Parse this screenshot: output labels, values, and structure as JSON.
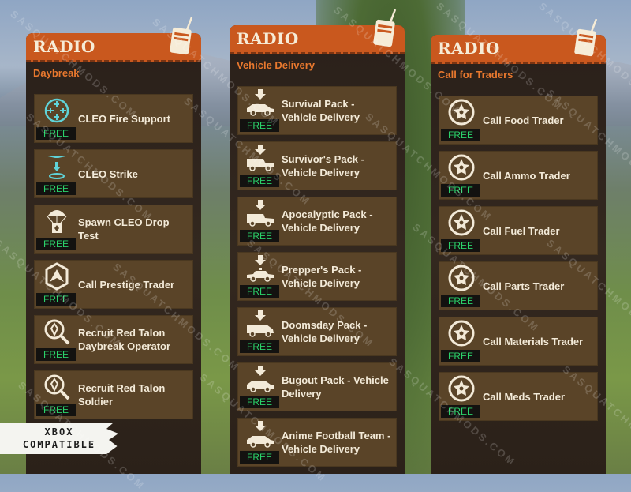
{
  "watermark": "SASQUATCHMODS.COM",
  "badge": {
    "line1": "XBOX",
    "line2": "COMPATIBLE"
  },
  "colors": {
    "header": "#c9581e",
    "subtitle": "#e8782e",
    "free": "#2bd26a",
    "item_bg": "#5a4428"
  },
  "panels": [
    {
      "title": "RADIO",
      "subtitle": "Daybreak",
      "items": [
        {
          "label": "CLEO Fire Support",
          "icon": "crosshair-icon",
          "price": "FREE"
        },
        {
          "label": "CLEO Strike",
          "icon": "airstrike-icon",
          "price": "FREE"
        },
        {
          "label": "Spawn CLEO Drop Test",
          "icon": "parachute-drop-icon",
          "price": "FREE"
        },
        {
          "label": "Call Prestige Trader",
          "icon": "prestige-chevron-icon",
          "price": "FREE"
        },
        {
          "label": "Recruit Red Talon Daybreak Operator",
          "icon": "recruit-search-icon",
          "price": "FREE"
        },
        {
          "label": "Recruit Red Talon Soldier",
          "icon": "recruit-search-icon",
          "price": "FREE"
        }
      ]
    },
    {
      "title": "RADIO",
      "subtitle": "Vehicle Delivery",
      "items": [
        {
          "label": "Survival Pack - Vehicle Delivery",
          "icon": "car-delivery-icon",
          "price": "FREE"
        },
        {
          "label": "Survivor's Pack - Vehicle Delivery",
          "icon": "jeep-delivery-icon",
          "price": "FREE"
        },
        {
          "label": "Apocalyptic Pack - Vehicle Delivery",
          "icon": "jeep-delivery-icon",
          "price": "FREE"
        },
        {
          "label": "Prepper's Pack - Vehicle Delivery",
          "icon": "police-car-delivery-icon",
          "price": "FREE"
        },
        {
          "label": "Doomsday Pack - Vehicle Delivery",
          "icon": "van-delivery-icon",
          "price": "FREE"
        },
        {
          "label": "Bugout Pack - Vehicle Delivery",
          "icon": "car-delivery-icon",
          "price": "FREE"
        },
        {
          "label": "Anime Football Team - Vehicle Delivery",
          "icon": "car-delivery-icon",
          "price": "FREE"
        }
      ]
    },
    {
      "title": "RADIO",
      "subtitle": "Call for Traders",
      "items": [
        {
          "label": "Call Food Trader",
          "icon": "trader-star-icon",
          "price": "FREE"
        },
        {
          "label": "Call Ammo Trader",
          "icon": "trader-star-icon",
          "price": "FREE"
        },
        {
          "label": "Call Fuel Trader",
          "icon": "trader-star-icon",
          "price": "FREE"
        },
        {
          "label": "Call Parts Trader",
          "icon": "trader-star-icon",
          "price": "FREE"
        },
        {
          "label": "Call Materials Trader",
          "icon": "trader-star-icon",
          "price": "FREE"
        },
        {
          "label": "Call Meds Trader",
          "icon": "trader-star-icon",
          "price": "FREE"
        }
      ]
    }
  ]
}
